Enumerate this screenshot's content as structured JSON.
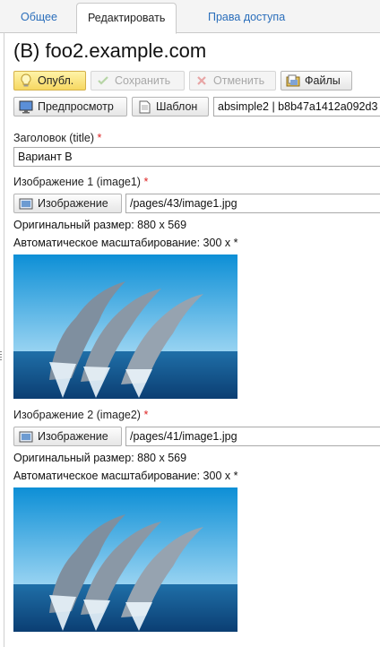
{
  "tabs": [
    {
      "label": "Общее"
    },
    {
      "label": "Редактировать"
    },
    {
      "label": "Права доступа"
    }
  ],
  "page_title": "(B) foo2.example.com",
  "toolbar": {
    "publish": "Опубл.",
    "save": "Сохранить",
    "cancel": "Отменить",
    "files": "Файлы",
    "preview": "Предпросмотр",
    "template": "Шаблон",
    "template_value": "absimple2 | b8b47a1412a092d3"
  },
  "fields": {
    "title": {
      "label": "Заголовок (title)",
      "required_mark": "*",
      "value": "Вариант B"
    },
    "image1": {
      "label": "Изображение 1 (image1)",
      "required_mark": "*",
      "button": "Изображение",
      "path": "/pages/43/image1.jpg",
      "original_size": "Оригинальный размер: 880 x 569",
      "auto_scale": "Автоматическое масштабирование: 300 x *"
    },
    "image2": {
      "label": "Изображение 2 (image2)",
      "required_mark": "*",
      "button": "Изображение",
      "path": "/pages/41/image1.jpg",
      "original_size": "Оригинальный размер: 880 x 569",
      "auto_scale": "Автоматическое масштабирование: 300 x *"
    }
  },
  "icons": {
    "publish": "lightbulb-icon",
    "save": "checkmark-icon",
    "cancel": "x-icon",
    "files": "folder-icon",
    "preview": "monitor-icon",
    "template": "document-icon",
    "image": "image-icon"
  },
  "colors": {
    "link": "#2a6ebb",
    "required": "#dd2222",
    "publish_bg": "#f6d862"
  }
}
